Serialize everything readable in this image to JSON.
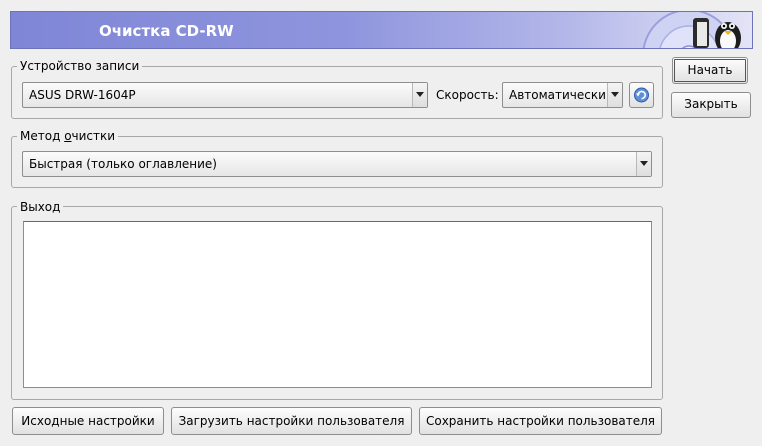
{
  "window": {
    "title": "Очистка CD-RW"
  },
  "recorder": {
    "group_label": "Устройство записи",
    "device": "ASUS DRW-1604P",
    "speed_label": "Скорость:",
    "speed_value": "Автоматически"
  },
  "method": {
    "group_label_pre": "Метод ",
    "group_label_accel": "о",
    "group_label_post": "чистки",
    "value": "Быстрая (только оглавление)"
  },
  "output": {
    "group_label": "Выход",
    "text": ""
  },
  "buttons": {
    "start": "Начать",
    "close": "Закрыть",
    "defaults": "Исходные настройки",
    "load_user": "Загрузить настройки пользователя",
    "save_user": "Сохранить настройки пользователя"
  }
}
